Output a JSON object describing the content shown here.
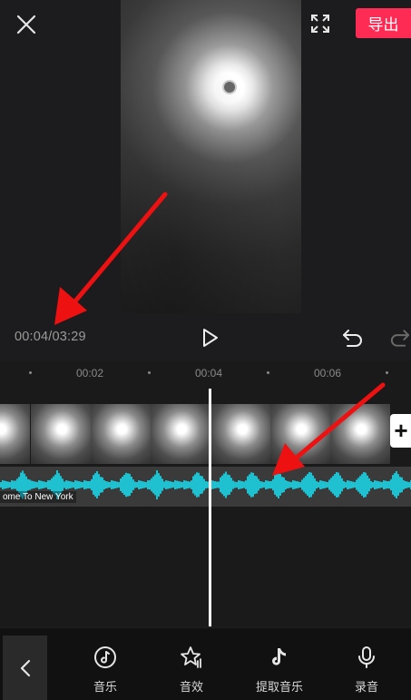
{
  "top_bar": {
    "export_label": "导出",
    "close_icon": "close-icon",
    "fullscreen_icon": "fullscreen-icon"
  },
  "player": {
    "timecode": "00:04/03:29",
    "play_icon": "play-icon",
    "undo_icon": "undo-icon",
    "redo_icon": "redo-icon"
  },
  "timeline": {
    "ticks": [
      "00:02",
      "00:04",
      "00:06"
    ],
    "audio_title": "ome To New York",
    "add_clip_label": "+"
  },
  "toolbar": {
    "back_icon": "chevron-left-icon",
    "items": [
      {
        "label": "音乐",
        "icon": "music-icon"
      },
      {
        "label": "音效",
        "icon": "sound-effect-icon"
      },
      {
        "label": "提取音乐",
        "icon": "extract-music-icon"
      },
      {
        "label": "录音",
        "icon": "microphone-icon"
      }
    ]
  },
  "colors": {
    "background": "#1c1c1e",
    "accent": "#fe2c55",
    "waveform": "#1fc0cf",
    "annotation": "#ee1111"
  }
}
